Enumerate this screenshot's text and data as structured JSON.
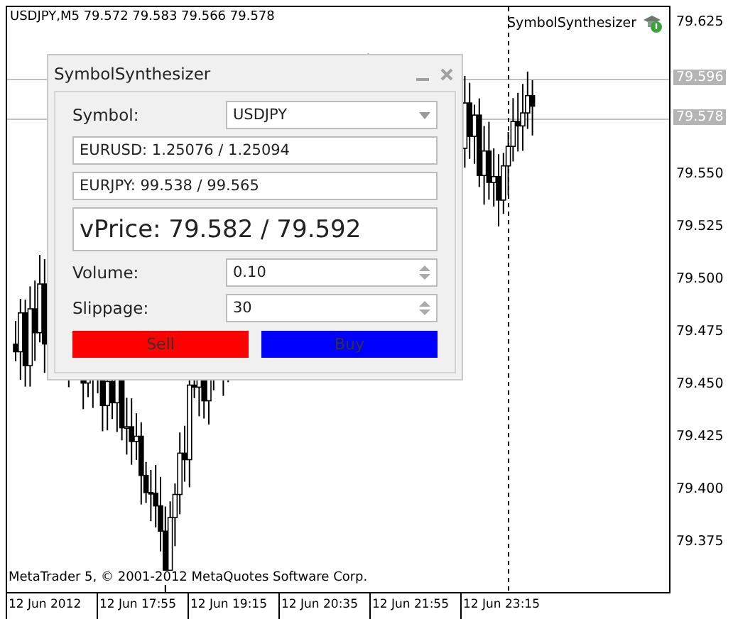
{
  "chart": {
    "header": "USDJPY,M5  79.572 79.583 79.566 79.578",
    "expert": "SymbolSynthesizer",
    "copyright": "MetaTrader 5, © 2001-2012 MetaQuotes Software Corp."
  },
  "price_axis": [
    {
      "label": "79.625",
      "kind": "tick"
    },
    {
      "label": "79.596",
      "kind": "marker"
    },
    {
      "label": "79.578",
      "kind": "marker"
    },
    {
      "label": "79.550",
      "kind": "tick"
    },
    {
      "label": "79.525",
      "kind": "tick"
    },
    {
      "label": "79.500",
      "kind": "tick"
    },
    {
      "label": "79.475",
      "kind": "tick"
    },
    {
      "label": "79.450",
      "kind": "tick"
    },
    {
      "label": "79.425",
      "kind": "tick"
    },
    {
      "label": "79.400",
      "kind": "tick"
    },
    {
      "label": "79.375",
      "kind": "tick"
    }
  ],
  "time_axis": [
    "12 Jun 2012",
    "12 Jun 17:55",
    "12 Jun 19:15",
    "12 Jun 20:35",
    "12 Jun 21:55",
    "12 Jun 23:15"
  ],
  "dialog": {
    "title": "SymbolSynthesizer",
    "symbol_label": "Symbol:",
    "symbol_value": "USDJPY",
    "quote_1": "EURUSD: 1.25076 / 1.25094",
    "quote_2": "EURJPY: 99.538 / 99.565",
    "vprice": "vPrice: 79.582 / 79.592",
    "volume_label": "Volume:",
    "volume_value": "0.10",
    "slippage_label": "Slippage:",
    "slippage_value": "30",
    "sell": "Sell",
    "buy": "Buy"
  }
}
